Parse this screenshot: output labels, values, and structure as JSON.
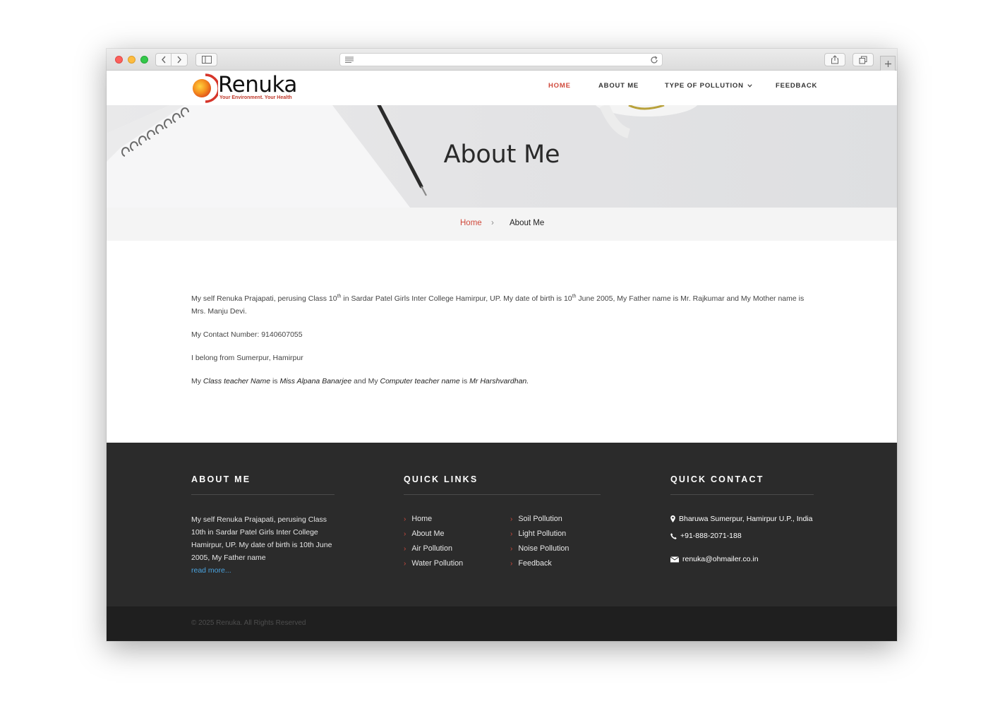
{
  "browser": {
    "icons": [
      "back-icon",
      "forward-icon",
      "sidebar-icon",
      "reader-icon",
      "reload-icon",
      "share-icon",
      "tabs-icon",
      "plus-icon"
    ]
  },
  "brand": {
    "name": "Renuka",
    "tagline": "Your Environment. Your Health",
    "accent": "#d04a3c"
  },
  "nav": {
    "home": "HOME",
    "about": "ABOUT ME",
    "types": "TYPE OF POLLUTION",
    "feedback": "FEEDBACK"
  },
  "hero": {
    "title": "About Me"
  },
  "breadcrumb": {
    "home": "Home",
    "separator": "›",
    "current": "About Me"
  },
  "content": {
    "p1_a": "My self Renuka Prajapati, perusing Class 10",
    "p1_sup1": "th",
    "p1_b": " in Sardar Patel Girls Inter College Hamirpur, UP. My date of birth is 10",
    "p1_sup2": "th",
    "p1_c": " June 2005, My Father name is Mr. Rajkumar and My Mother name is Mrs. Manju Devi.",
    "p2": "My Contact Number: 9140607055",
    "p3": "I belong from Sumerpur, Hamirpur",
    "p4_a": "My ",
    "p4_b": "Class teacher Name",
    "p4_c": " is ",
    "p4_d": "Miss Alpana Banarjee",
    "p4_e": " and My ",
    "p4_f": "Computer teacher name",
    "p4_g": " is ",
    "p4_h": "Mr Harshvardhan."
  },
  "footer": {
    "about_heading": "ABOUT ME",
    "about_text": "My self Renuka Prajapati, perusing Class 10th in Sardar Patel Girls Inter College Hamirpur, UP. My date of birth is 10th June 2005, My Father name",
    "read_more": "read more...",
    "links_heading": "QUICK LINKS",
    "links": [
      "Home",
      "About Me",
      "Air Pollution",
      "Water Pollution",
      "Soil Pollution",
      "Light Pollution",
      "Noise Pollution",
      "Feedback"
    ],
    "contact_heading": "QUICK CONTACT",
    "address": "Bharuwa Sumerpur, Hamirpur U.P., India",
    "phone": "+91-888-2071-188",
    "email": "renuka@ohmailer.co.in",
    "copyright": "© 2025 Renuka. All Rights Reserved"
  }
}
